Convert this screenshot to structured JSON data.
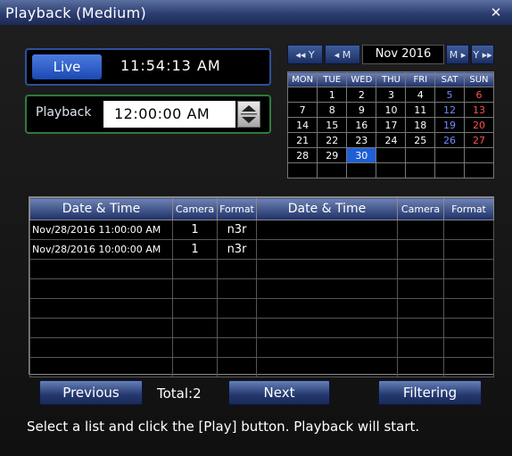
{
  "window": {
    "title": "Playback (Medium)",
    "close_glyph": "✕"
  },
  "live": {
    "button_label": "Live",
    "time": "11:54:13 AM"
  },
  "playback": {
    "label": "Playback",
    "time": "12:00:00 AM"
  },
  "calendar": {
    "nav": {
      "prev_year": "◂◂ Y",
      "prev_month": "◂ M",
      "next_month": "M ▸",
      "next_year": "Y ▸▸"
    },
    "month_year": "Nov 2016",
    "weekdays": [
      "MON",
      "TUE",
      "WED",
      "THU",
      "FRI",
      "SAT",
      "SUN"
    ],
    "weeks": [
      [
        "",
        "1",
        "2",
        "3",
        "4",
        "5",
        "6"
      ],
      [
        "7",
        "8",
        "9",
        "10",
        "11",
        "12",
        "13"
      ],
      [
        "14",
        "15",
        "16",
        "17",
        "18",
        "19",
        "20"
      ],
      [
        "21",
        "22",
        "23",
        "24",
        "25",
        "26",
        "27"
      ],
      [
        "28",
        "29",
        "30",
        "",
        "",
        "",
        ""
      ],
      [
        "",
        "",
        "",
        "",
        "",
        "",
        ""
      ]
    ],
    "selected_day": "30",
    "colors": {
      "saturday": "#6e8dff",
      "sunday": "#ff5050",
      "selected": "#1f5fd6"
    }
  },
  "results": {
    "headers": [
      "Date & Time",
      "Camera",
      "Format",
      "Date & Time",
      "Camera",
      "Format"
    ],
    "rows": [
      {
        "date_time": "Nov/28/2016 11:00:00 AM",
        "camera": "1",
        "format": "n3r"
      },
      {
        "date_time": "Nov/28/2016 10:00:00 AM",
        "camera": "1",
        "format": "n3r"
      }
    ]
  },
  "footer": {
    "previous_label": "Previous",
    "total_text": "Total:2",
    "next_label": "Next",
    "filtering_label": "Filtering",
    "hint": "Select a list and click the [Play] button. Playback will start."
  }
}
